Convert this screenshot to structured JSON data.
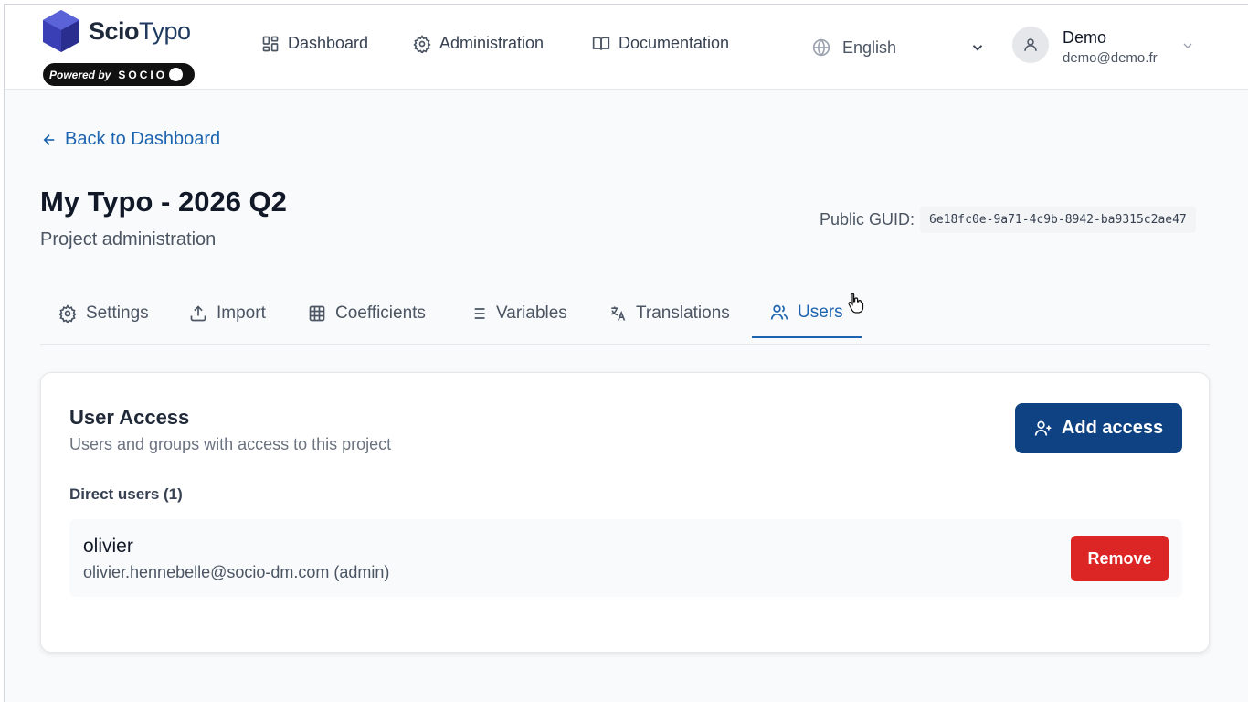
{
  "header": {
    "logo": {
      "scio": "Scio",
      "typo": "Typo",
      "powered_by": "Powered by",
      "socio": "SOCIO"
    },
    "nav": [
      {
        "label": "Dashboard",
        "icon": "dashboard-icon"
      },
      {
        "label": "Administration",
        "icon": "gear-icon"
      },
      {
        "label": "Documentation",
        "icon": "book-icon"
      }
    ],
    "language": {
      "value": "English",
      "icon": "globe-icon"
    },
    "user": {
      "name": "Demo",
      "email": "demo@demo.fr"
    }
  },
  "page": {
    "back_label": "Back to Dashboard",
    "title": "My Typo - 2026 Q2",
    "subtitle": "Project administration",
    "guid_label": "Public GUID:",
    "guid_value": "6e18fc0e-9a71-4c9b-8942-ba9315c2ae47"
  },
  "tabs": [
    {
      "label": "Settings",
      "icon": "gear-icon"
    },
    {
      "label": "Import",
      "icon": "upload-icon"
    },
    {
      "label": "Coefficients",
      "icon": "table-icon"
    },
    {
      "label": "Variables",
      "icon": "list-icon"
    },
    {
      "label": "Translations",
      "icon": "translate-icon"
    },
    {
      "label": "Users",
      "icon": "users-icon",
      "active": true
    }
  ],
  "access": {
    "title": "User Access",
    "subtitle": "Users and groups with access to this project",
    "add_label": "Add access",
    "direct_users_label": "Direct users (1)",
    "users": [
      {
        "name": "olivier",
        "email": "olivier.hennebelle@socio-dm.com (admin)",
        "remove_label": "Remove"
      }
    ]
  },
  "colors": {
    "primary": "#0f4283",
    "link": "#1d64b0",
    "danger": "#dc2626"
  }
}
